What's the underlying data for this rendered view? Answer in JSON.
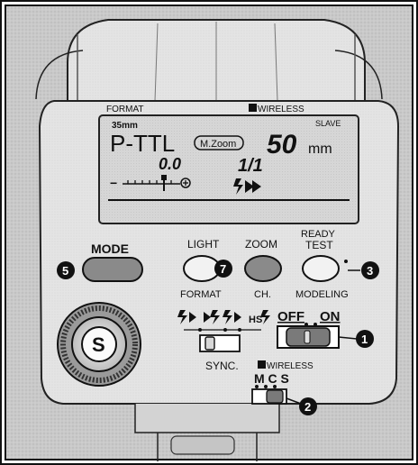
{
  "lcd": {
    "format_label": "FORMAT",
    "wireless_label": "WIRELESS",
    "focal_format": "35mm",
    "mode": "P-TTL",
    "zoom_indicator": "M.Zoom",
    "slave_label": "SLAVE",
    "zoom_value": "50",
    "zoom_unit": "mm",
    "exposure_comp": "0.0",
    "ratio": "1/1"
  },
  "buttons": {
    "mode": "MODE",
    "light_top": "LIGHT",
    "light_bottom": "FORMAT",
    "zoom_top": "ZOOM",
    "zoom_bottom": "CH.",
    "ready_top": "READY",
    "ready_mid": "TEST",
    "ready_bottom": "MODELING"
  },
  "switches": {
    "off_label": "OFF",
    "on_label": "ON",
    "sync_label": "SYNC.",
    "wireless_label": "WIRELESS",
    "mcs_label": "M C S",
    "hs_label": "HS"
  },
  "dial": {
    "letter": "S"
  },
  "callouts": {
    "c1": "1",
    "c2": "2",
    "c3": "3",
    "c5": "5",
    "c7": "7"
  }
}
